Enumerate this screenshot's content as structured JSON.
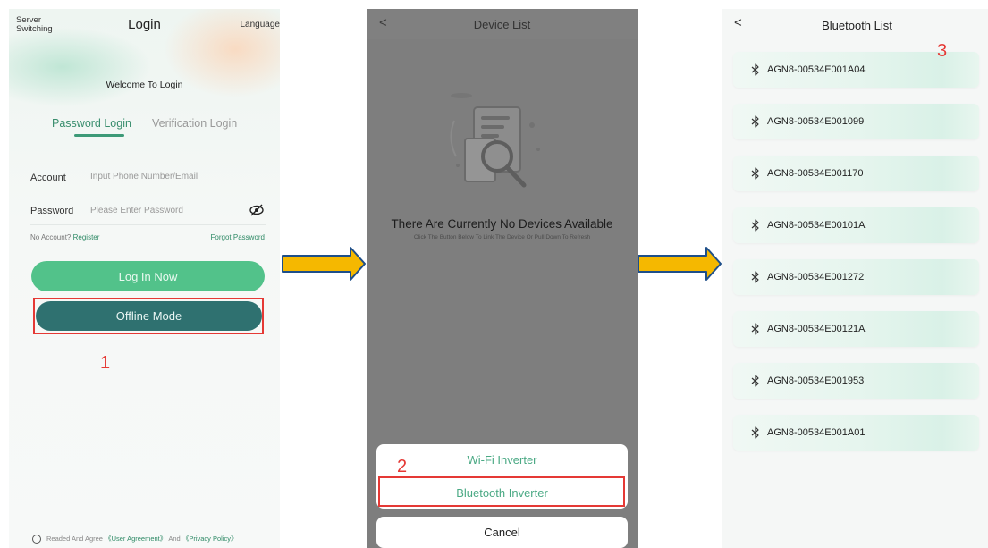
{
  "login": {
    "server_switching": "Server Switching",
    "title": "Login",
    "language": "Language",
    "welcome": "Welcome To Login",
    "tab_password": "Password Login",
    "tab_verification": "Verification Login",
    "account_label": "Account",
    "account_placeholder": "Input Phone Number/Email",
    "password_label": "Password",
    "password_placeholder": "Please Enter Password",
    "no_account": "No Account?",
    "register": "Register",
    "forgot_password": "Forgot Password",
    "login_button": "Log In Now",
    "offline_button": "Offline Mode",
    "agree_prefix": "Readed And Agree",
    "user_agreement": "《User Agreement》",
    "agree_and": "And",
    "privacy_policy": "《Privacy Policy》"
  },
  "device_list": {
    "back": "<",
    "title": "Device List",
    "empty_title": "There Are Currently No Devices Available",
    "empty_subtitle": "Click The Button Below To Link The Device Or Pull Down To Refresh",
    "option_wifi": "Wi-Fi Inverter",
    "option_bluetooth": "Bluetooth Inverter",
    "cancel": "Cancel"
  },
  "bluetooth_list": {
    "back": "<",
    "title": "Bluetooth List",
    "devices": [
      "AGN8-00534E001A04",
      "AGN8-00534E001099",
      "AGN8-00534E001170",
      "AGN8-00534E00101A",
      "AGN8-00534E001272",
      "AGN8-00534E00121A",
      "AGN8-00534E001953",
      "AGN8-00534E001A01"
    ]
  },
  "annotations": {
    "step1": "1",
    "step2": "2",
    "step3": "3",
    "highlight_color": "#e53935",
    "arrow_color": "#f5b800"
  },
  "colors": {
    "primary_green": "#52c28a",
    "offline_teal": "#2f7170",
    "link_green": "#2f8a66"
  }
}
